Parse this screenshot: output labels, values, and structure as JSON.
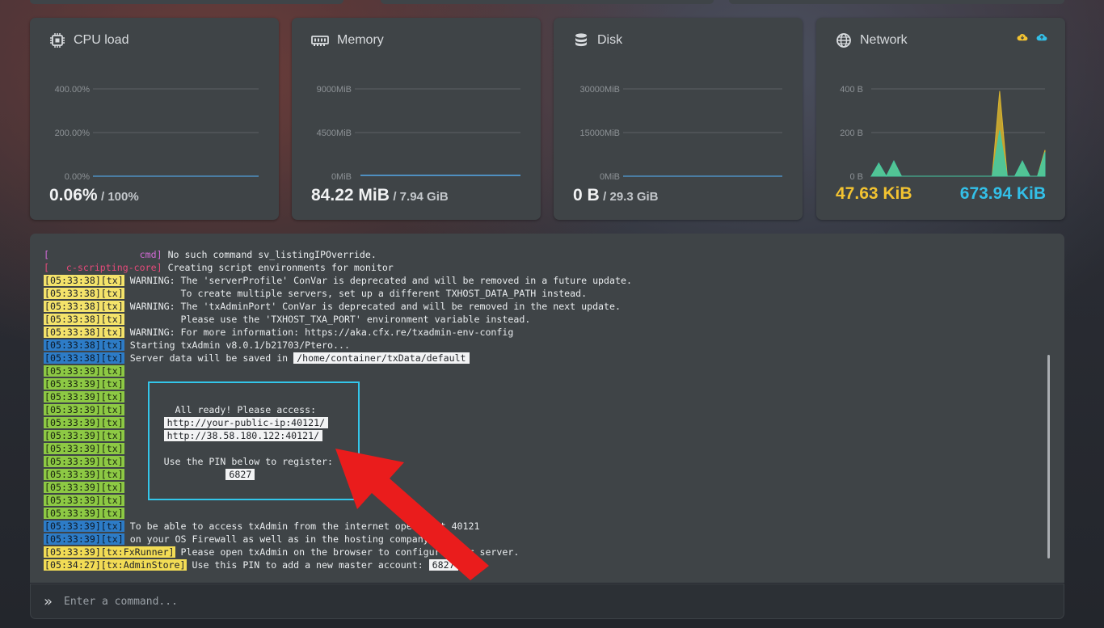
{
  "cards": {
    "cpu": {
      "title": "CPU load",
      "value": "0.06%",
      "total": "/ 100%",
      "ticks": [
        "400.00%",
        "200.00%",
        "0.00%"
      ],
      "usage_fraction": 0.0006
    },
    "memory": {
      "title": "Memory",
      "value": "84.22 MiB",
      "total": "/ 7.94 GiB",
      "ticks": [
        "9000MiB",
        "4500MiB",
        "0MiB"
      ]
    },
    "disk": {
      "title": "Disk",
      "value": "0 B",
      "total": "/ 29.3 GiB",
      "ticks": [
        "30000MiB",
        "15000MiB",
        "0MiB"
      ]
    },
    "network": {
      "title": "Network",
      "rx": "47.63 KiB",
      "tx": "673.94 KiB",
      "ticks": [
        "400 B",
        "200 B",
        "0 B"
      ],
      "icons": [
        "cloud-download-icon",
        "cloud-upload-icon"
      ]
    }
  },
  "chart_data": {
    "type": "area",
    "title": "Network",
    "ylim": [
      0,
      400
    ],
    "series": [
      {
        "values": [
          0,
          50,
          0,
          60,
          0,
          0,
          0,
          0,
          0,
          0,
          0,
          0,
          0,
          0,
          0,
          0,
          0,
          390,
          0,
          0,
          60,
          0,
          0,
          120
        ]
      },
      {
        "values": [
          0,
          60,
          0,
          70,
          0,
          0,
          0,
          0,
          0,
          0,
          0,
          0,
          0,
          0,
          0,
          0,
          0,
          210,
          0,
          0,
          70,
          0,
          0,
          110
        ]
      }
    ],
    "colors": [
      "#d9b42f",
      "#46c8a0"
    ]
  },
  "console": {
    "lines": [
      {
        "tag": "[                cmd]",
        "tag_style": "mag",
        "text": " No such command sv_listingIPOverride."
      },
      {
        "tag": "[   c-scripting-core]",
        "tag_style": "pink",
        "text": " Creating script environments for monitor"
      },
      {
        "tag": "[05:33:38][tx]",
        "tag_style": "y",
        "text": " WARNING: The 'serverProfile' ConVar is deprecated and will be removed in a future update."
      },
      {
        "tag": "[05:33:38][tx]",
        "tag_style": "y",
        "text": "          To create multiple servers, set up a different TXHOST_DATA_PATH instead."
      },
      {
        "tag": "[05:33:38][tx]",
        "tag_style": "y",
        "text": " WARNING: The 'txAdminPort' ConVar is deprecated and will be removed in the next update."
      },
      {
        "tag": "[05:33:38][tx]",
        "tag_style": "y",
        "text": "          Please use the 'TXHOST_TXA_PORT' environment variable instead."
      },
      {
        "tag": "[05:33:38][tx]",
        "tag_style": "y",
        "text": " WARNING: For more information: https://aka.cfx.re/txadmin-env-config"
      },
      {
        "tag": "[05:33:38][tx]",
        "tag_style": "b",
        "text": " Starting txAdmin v8.0.1/b21703/Ptero..."
      },
      {
        "tag": "[05:33:38][tx]",
        "tag_style": "b",
        "text": " Server data will be saved in ",
        "hl": "/home/container/txData/default"
      },
      {
        "tag": "[05:33:39][tx]",
        "tag_style": "g",
        "text": ""
      },
      {
        "tag": "[05:33:39][tx]",
        "tag_style": "g",
        "text": ""
      },
      {
        "tag": "[05:33:39][tx]",
        "tag_style": "g",
        "text": ""
      },
      {
        "tag": "[05:33:39][tx]",
        "tag_style": "g",
        "text": "         All ready! Please access:"
      },
      {
        "tag": "[05:33:39][tx]",
        "tag_style": "g",
        "text": "       ",
        "hl": "http://your-public-ip:40121/"
      },
      {
        "tag": "[05:33:39][tx]",
        "tag_style": "g",
        "text": "       ",
        "hl": "http://38.58.180.122:40121/"
      },
      {
        "tag": "[05:33:39][tx]",
        "tag_style": "g",
        "text": ""
      },
      {
        "tag": "[05:33:39][tx]",
        "tag_style": "g",
        "text": "       Use the PIN below to register:"
      },
      {
        "tag": "[05:33:39][tx]",
        "tag_style": "g",
        "text": "                  ",
        "hl": "6827"
      },
      {
        "tag": "[05:33:39][tx]",
        "tag_style": "g",
        "text": ""
      },
      {
        "tag": "[05:33:39][tx]",
        "tag_style": "g",
        "text": ""
      },
      {
        "tag": "[05:33:39][tx]",
        "tag_style": "g",
        "text": ""
      },
      {
        "tag": "[05:33:39][tx]",
        "tag_style": "b",
        "text": " To be able to access txAdmin from the internet open port 40121"
      },
      {
        "tag": "[05:33:39][tx]",
        "tag_style": "b",
        "text": " on your OS Firewall as well as in the hosting company."
      },
      {
        "tag": "[05:33:39][tx:FxRunner]",
        "tag_style": "y2",
        "text": " Please open txAdmin on the browser to configure your server."
      },
      {
        "tag": "[05:34:27][tx:AdminStore]",
        "tag_style": "y2",
        "text": " Use this PIN to add a new master account: ",
        "hl": "6827"
      }
    ]
  },
  "command": {
    "prompt_icon": "double-chevron-right-icon",
    "placeholder": "Enter a command..."
  }
}
